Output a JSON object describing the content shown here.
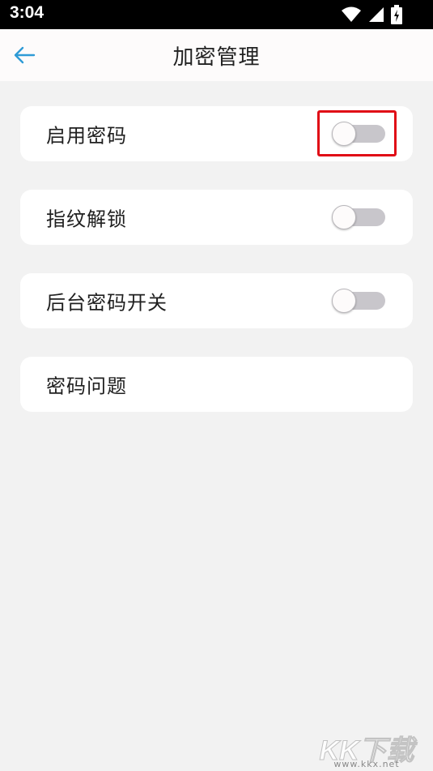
{
  "status_bar": {
    "time": "3:04"
  },
  "header": {
    "title": "加密管理",
    "back_icon": "arrow-left-icon",
    "accent": "#2f9bd6"
  },
  "settings": [
    {
      "label": "启用密码",
      "toggle_on": false,
      "highlighted": true
    },
    {
      "label": "指纹解锁",
      "toggle_on": false
    },
    {
      "label": "后台密码开关",
      "toggle_on": false
    },
    {
      "label": "密码问题"
    }
  ],
  "watermark": {
    "text": "KK下载",
    "url": "www.kkx.net"
  },
  "colors": {
    "highlight": "#e00c16",
    "toggle_track": "#c8c6cb",
    "background": "#f2f2f2"
  }
}
